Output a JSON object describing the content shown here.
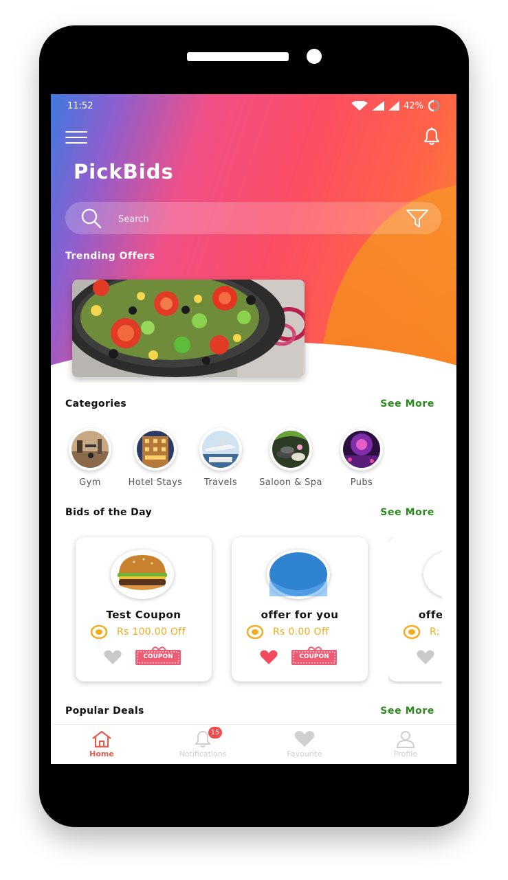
{
  "status_bar": {
    "time": "11:52",
    "battery": "42%"
  },
  "header": {
    "app_title": "PickBids"
  },
  "search": {
    "placeholder": "Search"
  },
  "trending": {
    "title": "Trending Offers"
  },
  "categories": {
    "title": "Categories",
    "see_more": "See More",
    "items": [
      {
        "label": "Gym",
        "icon": "gym-image"
      },
      {
        "label": "Hotel Stays",
        "icon": "hotel-image"
      },
      {
        "label": "Travels",
        "icon": "airplane-image"
      },
      {
        "label": "Saloon & Spa",
        "icon": "spa-image"
      },
      {
        "label": "Pubs",
        "icon": "pub-image"
      }
    ]
  },
  "bids": {
    "title": "Bids of the Day",
    "see_more": "See More",
    "items": [
      {
        "title": "Test Coupon",
        "price": "Rs 100.00 Off",
        "favourite": false,
        "image": "burger-image"
      },
      {
        "title": "offer for you",
        "price": "Rs 0.00 Off",
        "favourite": true,
        "image": "blue-placeholder-image"
      },
      {
        "title": "offe",
        "price": "R:",
        "favourite": false,
        "image": "partial-card-image"
      }
    ],
    "coupon_label": "COUPON"
  },
  "popular": {
    "title": "Popular Deals",
    "see_more": "See More"
  },
  "bottom_nav": {
    "items": [
      {
        "label": "Home",
        "icon": "home-icon",
        "active": true
      },
      {
        "label": "Notifications",
        "icon": "bell-icon",
        "badge": "15"
      },
      {
        "label": "Favourite",
        "icon": "heart-icon"
      },
      {
        "label": "Profile",
        "icon": "user-icon"
      }
    ]
  },
  "colors": {
    "accent_green": "#2a8a1c",
    "price_yellow": "#f3ad1b",
    "favourite_red": "#f24b5e",
    "nav_active": "#e65a4d",
    "badge_red": "#f24b4b"
  }
}
